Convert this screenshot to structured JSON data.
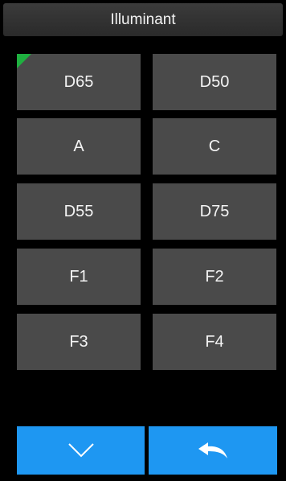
{
  "header": {
    "title": "Illuminant"
  },
  "illuminants": [
    {
      "label": "D65",
      "selected": true
    },
    {
      "label": "D50",
      "selected": false
    },
    {
      "label": "A",
      "selected": false
    },
    {
      "label": "C",
      "selected": false
    },
    {
      "label": "D55",
      "selected": false
    },
    {
      "label": "D75",
      "selected": false
    },
    {
      "label": "F1",
      "selected": false
    },
    {
      "label": "F2",
      "selected": false
    },
    {
      "label": "F3",
      "selected": false
    },
    {
      "label": "F4",
      "selected": false
    }
  ],
  "footer": {
    "down_icon": "chevron-down-icon",
    "back_icon": "return-arrow-icon"
  },
  "colors": {
    "background": "#000000",
    "tile": "#4a4a4a",
    "accent": "#1e97f2",
    "selected_marker": "#1fb040"
  }
}
